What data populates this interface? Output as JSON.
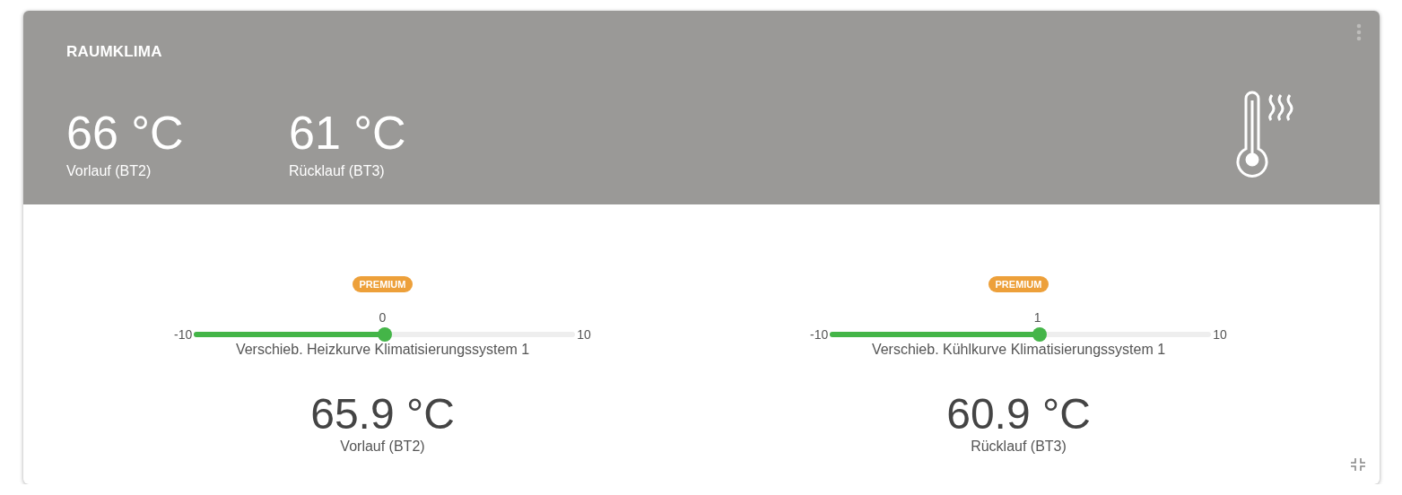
{
  "card": {
    "title": "RAUMKLIMA",
    "readings": [
      {
        "value": "66 °C",
        "label": "Vorlauf (BT2)"
      },
      {
        "value": "61 °C",
        "label": "Rücklauf (BT3)"
      }
    ]
  },
  "controls": [
    {
      "badge": "PREMIUM",
      "value": "0",
      "min": "-10",
      "max": "10",
      "level": 0.5,
      "label": "Verschieb. Heizkurve Klimatisierungssystem 1",
      "reading": "65.9 °C",
      "reading_label": "Vorlauf (BT2)"
    },
    {
      "badge": "PREMIUM",
      "value": "1",
      "min": "-10",
      "max": "10",
      "level": 0.55,
      "label": "Verschieb. Kühlkurve Klimatisierungssystem 1",
      "reading": "60.9 °C",
      "reading_label": "Rücklauf (BT3)"
    }
  ]
}
